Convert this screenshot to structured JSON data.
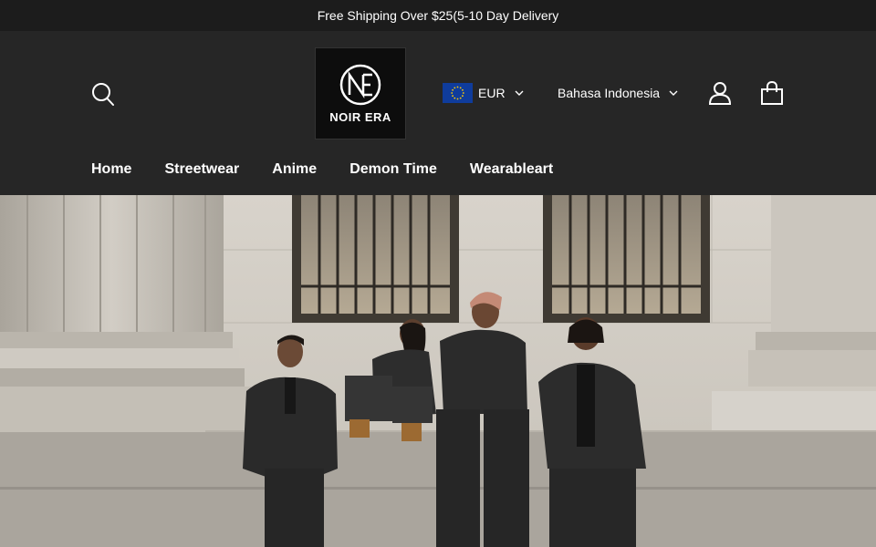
{
  "announcement": {
    "text": "Free Shipping Over $25⁣(5-10 Day Delivery⁣"
  },
  "header": {
    "logo": {
      "text": "NOIR ERA",
      "mark": "NE"
    },
    "currency": {
      "label": "EUR",
      "flag": "eu-flag"
    },
    "language": {
      "label": "Bahasa Indonesia"
    },
    "icons": {
      "search": "search-icon",
      "account": "user-icon",
      "cart": "bag-icon"
    }
  },
  "nav": {
    "items": [
      {
        "label": "Home"
      },
      {
        "label": "Streetwear"
      },
      {
        "label": "Anime"
      },
      {
        "label": "Demon Time"
      },
      {
        "label": "Wearableart"
      }
    ]
  },
  "colors": {
    "header_bg": "#262626",
    "announcement_bg": "#1c1c1c",
    "text": "#ffffff",
    "eu_blue": "#0f3c9c",
    "eu_star": "#ffcc00"
  }
}
